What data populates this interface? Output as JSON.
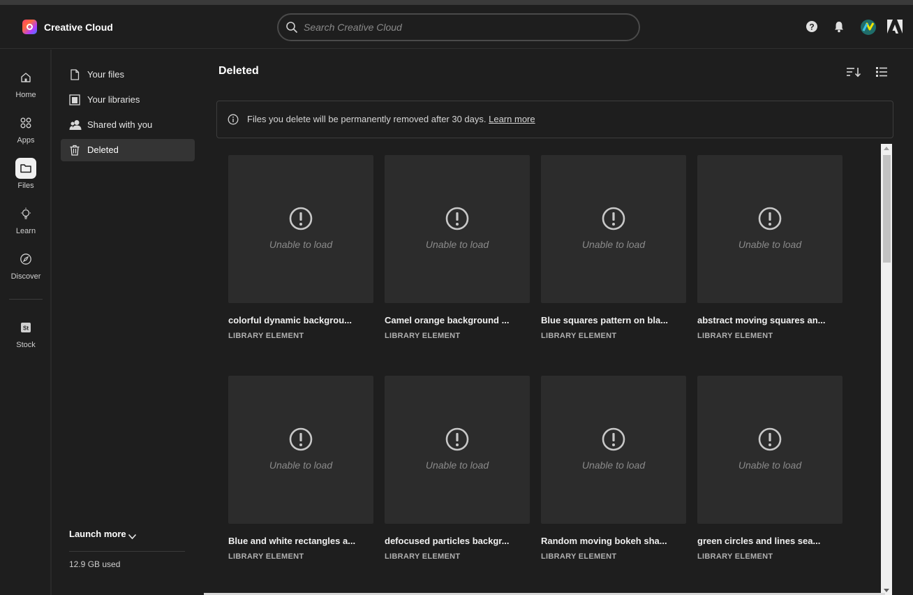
{
  "app": {
    "title": "Creative Cloud"
  },
  "search": {
    "placeholder": "Search Creative Cloud"
  },
  "header_icons": [
    "help-icon",
    "bell-icon",
    "avatar",
    "adobe-logo-icon"
  ],
  "rail": {
    "items": [
      {
        "label": "Home",
        "icon": "home-icon"
      },
      {
        "label": "Apps",
        "icon": "apps-grid-icon"
      },
      {
        "label": "Files",
        "icon": "folder-icon",
        "active": true
      },
      {
        "label": "Learn",
        "icon": "lightbulb-icon"
      },
      {
        "label": "Discover",
        "icon": "compass-icon"
      },
      {
        "label": "Stock",
        "icon": "stock-icon"
      }
    ]
  },
  "sidebar": {
    "items": [
      {
        "label": "Your files",
        "icon": "file-icon"
      },
      {
        "label": "Your libraries",
        "icon": "libraries-icon"
      },
      {
        "label": "Shared with you",
        "icon": "people-icon"
      },
      {
        "label": "Deleted",
        "icon": "trash-icon",
        "active": true
      }
    ],
    "launch_more": "Launch more",
    "storage": "12.9 GB used"
  },
  "main": {
    "title": "Deleted",
    "banner": {
      "text": "Files you delete will be permanently removed after 30 days.",
      "link": "Learn more"
    },
    "cards": [
      {
        "name": "colorful dynamic backgrou...",
        "type": "LIBRARY ELEMENT",
        "status": "Unable to load"
      },
      {
        "name": "Camel orange background ...",
        "type": "LIBRARY ELEMENT",
        "status": "Unable to load"
      },
      {
        "name": "Blue squares pattern on bla...",
        "type": "LIBRARY ELEMENT",
        "status": "Unable to load"
      },
      {
        "name": "abstract moving squares an...",
        "type": "LIBRARY ELEMENT",
        "status": "Unable to load"
      },
      {
        "name": "Blue and white rectangles a...",
        "type": "LIBRARY ELEMENT",
        "status": "Unable to load"
      },
      {
        "name": "defocused particles backgr...",
        "type": "LIBRARY ELEMENT",
        "status": "Unable to load"
      },
      {
        "name": "Random moving bokeh sha...",
        "type": "LIBRARY ELEMENT",
        "status": "Unable to load"
      },
      {
        "name": "green circles and lines sea...",
        "type": "LIBRARY ELEMENT",
        "status": "Unable to load"
      }
    ]
  }
}
